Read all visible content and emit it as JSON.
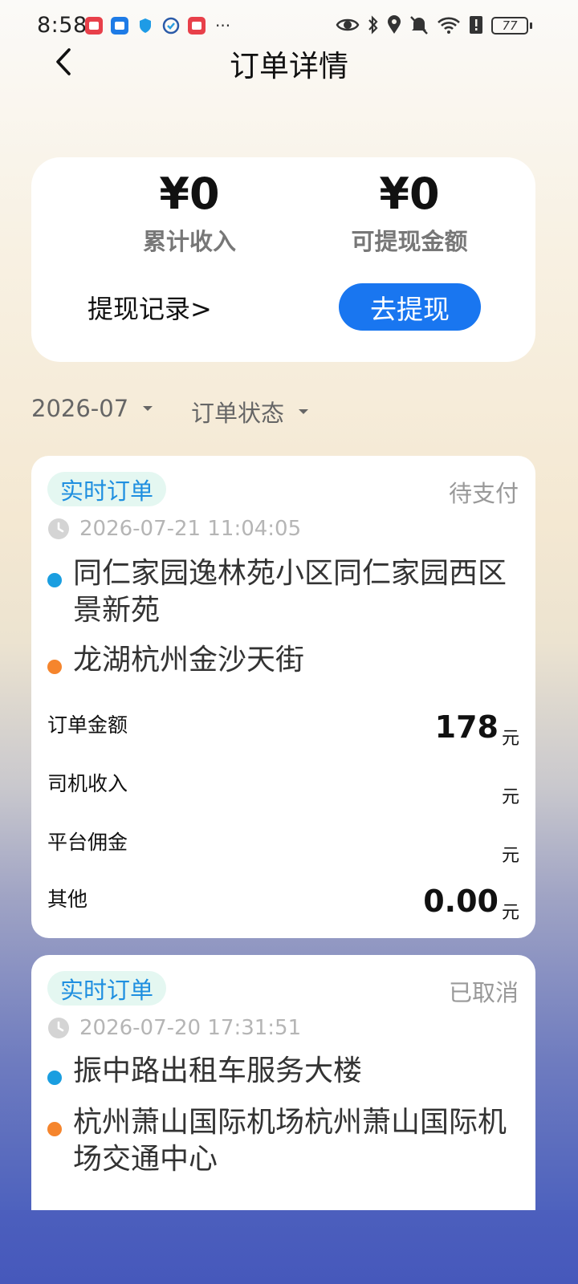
{
  "status_bar": {
    "time": "8:58",
    "more": "···",
    "battery": "77"
  },
  "header": {
    "title": "订单详情"
  },
  "summary": {
    "total_income_amount": "¥0",
    "total_income_label": "累计收入",
    "withdrawable_amount": "¥0",
    "withdrawable_label": "可提现金额",
    "withdraw_history": "提现记录>",
    "withdraw_button": "去提现"
  },
  "filters": {
    "month": "2026-07",
    "status": "订单状态"
  },
  "orders": [
    {
      "tag": "实时订单",
      "status": "待支付",
      "time": "2026-07-21 11:04:05",
      "from": "同仁家园逸林苑小区同仁家园西区景新苑",
      "to": "龙湖杭州金沙天街",
      "rows": [
        {
          "label": "订单金额",
          "value": "178",
          "unit": "元"
        },
        {
          "label": "司机收入",
          "value": "",
          "unit": "元"
        },
        {
          "label": "平台佣金",
          "value": "",
          "unit": "元"
        },
        {
          "label": "其他",
          "value": "0.00",
          "unit": "元"
        }
      ]
    },
    {
      "tag": "实时订单",
      "status": "已取消",
      "time": "2026-07-20 17:31:51",
      "from": "振中路出租车服务大楼",
      "to": "杭州萧山国际机场杭州萧山国际机场交通中心"
    }
  ],
  "colors": {
    "accent": "#1976f0",
    "tag_bg": "#e4f7f1",
    "tag_text": "#1f8fe0",
    "origin_dot": "#1a9ee0",
    "destination_dot": "#f5852d"
  }
}
